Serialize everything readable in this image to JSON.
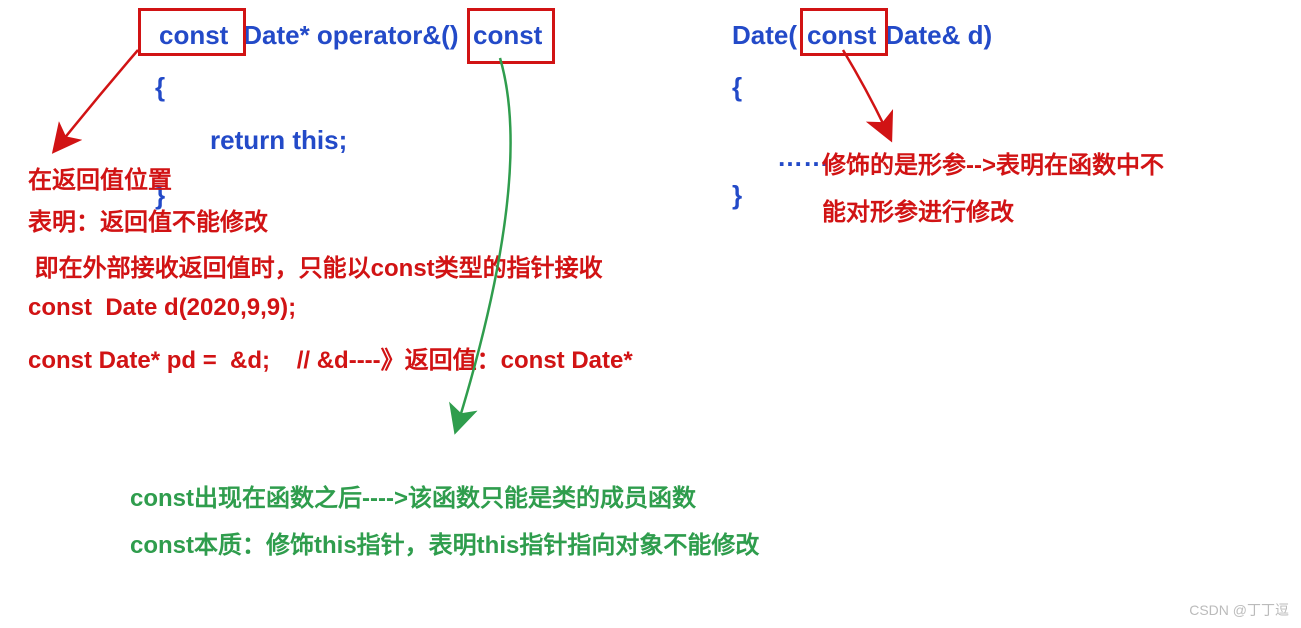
{
  "left_code": {
    "line1_a": "const",
    "line1_b": " Date* operator&()",
    "line1_c": "const",
    "brace_open": "{",
    "return": "return this;",
    "brace_close": "}"
  },
  "right_code": {
    "line1_a": "Date(",
    "line1_b": "const",
    "line1_c": " Date& d)",
    "brace_open": "{",
    "dots": "……",
    "brace_close": "}"
  },
  "red_left": {
    "l1": "在返回值位置",
    "l2": "表明：返回值不能修改",
    "l3": " 即在外部接收返回值时，只能以const类型的指针接收",
    "l4": "const  Date d(2020,9,9);",
    "l5": "const Date* pd =  &d;    // &d----》返回值：const Date*"
  },
  "red_right": {
    "l1": "修饰的是形参-->表明在函数中不",
    "l2": "能对形参进行修改"
  },
  "green": {
    "l1": "const出现在函数之后---->该函数只能是类的成员函数",
    "l2": "const本质：修饰this指针，表明this指针指向对象不能修改"
  },
  "watermark": "CSDN @丁丁逗"
}
